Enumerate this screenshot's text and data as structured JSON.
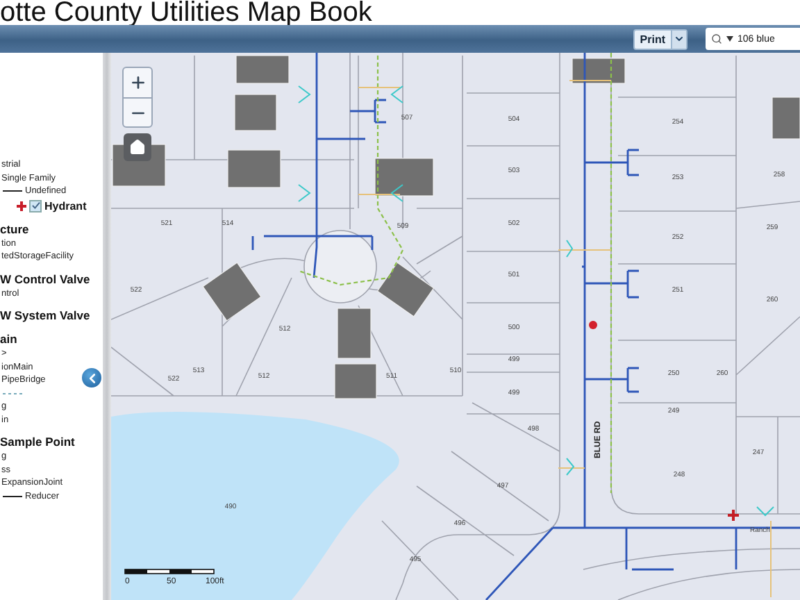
{
  "title": "otte County Utilities Map Book",
  "toolbar": {
    "print_button": "Print",
    "search": {
      "value": "106 blue"
    }
  },
  "legend": [
    {
      "kind": "text",
      "label": "strial"
    },
    {
      "kind": "text",
      "label": "Single Family"
    },
    {
      "kind": "line",
      "label": "Undefined"
    },
    {
      "kind": "checkbox",
      "label": "Hydrant",
      "checked": true
    },
    {
      "kind": "heading",
      "label": "cture"
    },
    {
      "kind": "text",
      "label": "tion"
    },
    {
      "kind": "text",
      "label": "tedStorageFacility"
    },
    {
      "kind": "heading",
      "label": "W Control Valve"
    },
    {
      "kind": "text",
      "label": "ntrol"
    },
    {
      "kind": "heading",
      "label": "W System Valve"
    },
    {
      "kind": "heading",
      "label": "ain"
    },
    {
      "kind": "text",
      "label": ">"
    },
    {
      "kind": "text",
      "label": "ionMain"
    },
    {
      "kind": "text",
      "label": "PipeBridge"
    },
    {
      "kind": "dash"
    },
    {
      "kind": "text",
      "label": "g"
    },
    {
      "kind": "text",
      "label": "in"
    },
    {
      "kind": "heading",
      "label": "Sample Point"
    },
    {
      "kind": "text",
      "label": "g"
    },
    {
      "kind": "text",
      "label": "ss"
    },
    {
      "kind": "text",
      "label": "ExpansionJoint"
    },
    {
      "kind": "line",
      "label": "Reducer"
    }
  ],
  "map": {
    "parcel_labels": [
      "507",
      "504",
      "503",
      "502",
      "501",
      "500",
      "499",
      "499",
      "498",
      "497",
      "496",
      "495",
      "490",
      "521",
      "514",
      "509",
      "522",
      "512",
      "522",
      "513",
      "512",
      "511",
      "510",
      "254",
      "253",
      "252",
      "251",
      "250",
      "249",
      "248",
      "247",
      "258",
      "259",
      "260",
      "260"
    ],
    "street_labels": [
      "BLUE RD",
      "Ranch"
    ],
    "scale_bar": {
      "labels": [
        "0",
        "50",
        "100ft"
      ]
    }
  }
}
